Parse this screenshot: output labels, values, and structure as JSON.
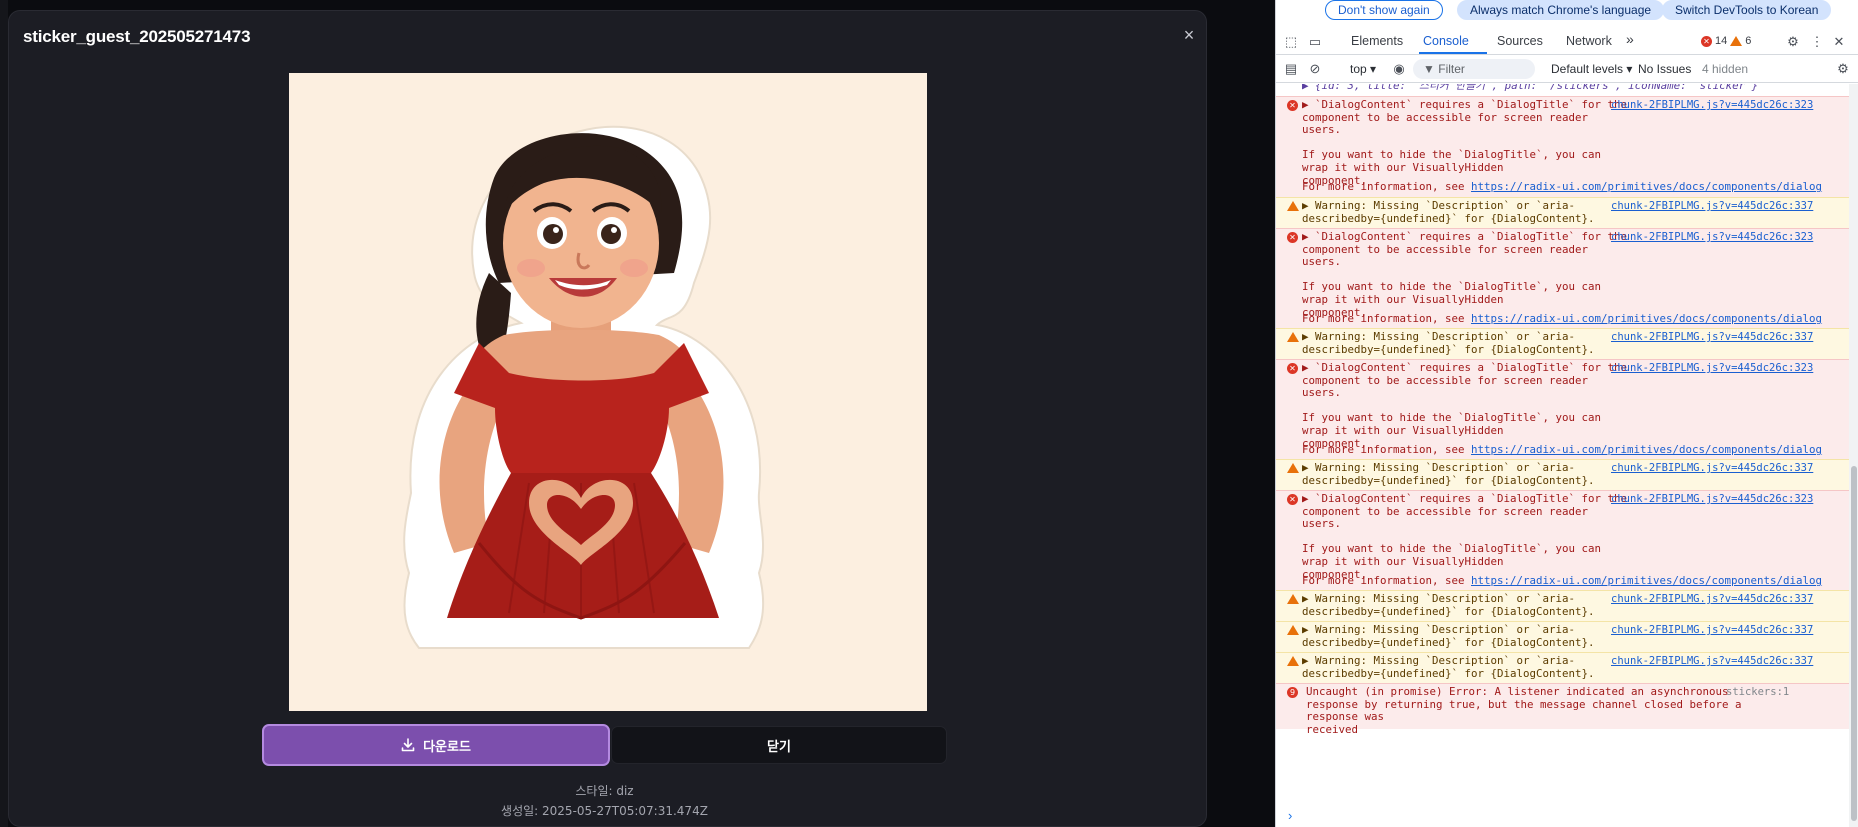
{
  "dialog": {
    "title": "sticker_guest_202505271473",
    "close_icon_glyph": "×",
    "image_alt": "pregnant girl sticker in red dress making heart hands",
    "download_label": "다운로드",
    "close_label": "닫기",
    "style_text": "스타일: diz",
    "created_text": "생성일: 2025-05-27T05:07:31.474Z"
  },
  "devtools": {
    "infobar": {
      "dont_show": "Don't show again",
      "always_match": "Always match Chrome's language",
      "switch_korean": "Switch DevTools to Korean"
    },
    "tabs": [
      "Elements",
      "Console",
      "Sources",
      "Network"
    ],
    "more_tabs": "»",
    "errors": "14",
    "warnings": "6",
    "context": "top ▾",
    "filter_placeholder": "Filter",
    "levels": "Default levels ▾",
    "issues": "No Issues",
    "hidden": "4 hidden",
    "top_line": "▶ {id: 3, title: '스티커 만들기', path: '/stickers', iconName: 'sticker'}",
    "err_msg": "▶ `DialogContent` requires a `DialogTitle` for the\ncomponent to be accessible for screen reader users.\n\nIf you want to hide the `DialogTitle`, you can wrap it with our VisuallyHidden\ncomponent.",
    "err_more": "For more information, see ",
    "err_link": "https://radix-ui.com/primitives/docs/components/dialog",
    "err_src": "chunk-2FBIPLMG.js?v=445dc26c:323",
    "warn_msg": "▶ Warning: Missing `Description` or `aria-\ndescribedby={undefined}` for {DialogContent}.",
    "warn_src": "chunk-2FBIPLMG.js?v=445dc26c:337",
    "uncaught_msg": "Uncaught (in promise) Error: A listener indicated an asynchronous\nresponse by returning true, but the message channel closed before a response was\nreceived",
    "uncaught_src": "stickers:1",
    "uncaught_count": "9",
    "prompt": "›"
  },
  "colors": {
    "accent": "#7c4fad",
    "dialog_bg": "#1c1d24",
    "error_bg": "#fcebeb",
    "warning_bg": "#fef8e1",
    "link": "#1a5fd0"
  }
}
